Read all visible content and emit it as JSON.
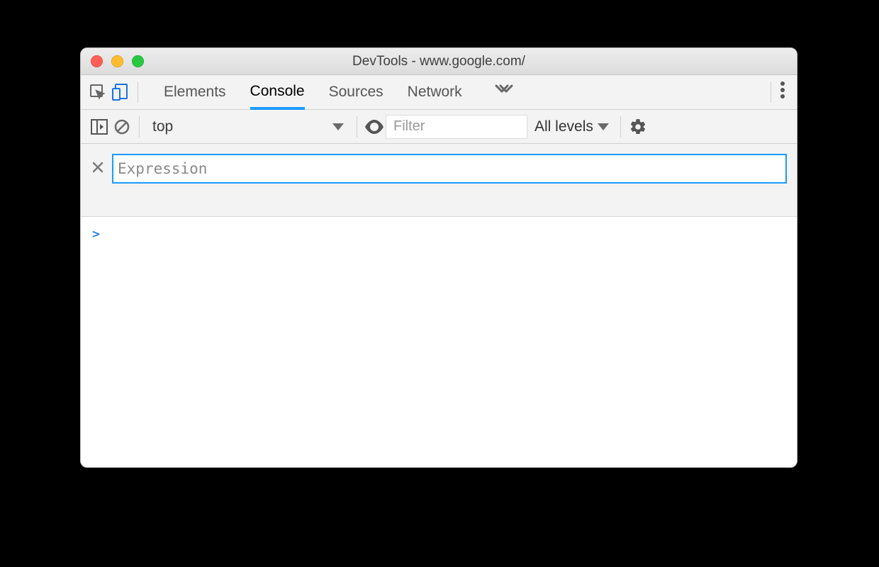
{
  "window": {
    "title": "DevTools - www.google.com/"
  },
  "tabs": {
    "items": [
      "Elements",
      "Console",
      "Sources",
      "Network"
    ],
    "active_index": 1
  },
  "console_toolbar": {
    "context": "top",
    "filter_placeholder": "Filter",
    "levels_label": "All levels"
  },
  "live_expression": {
    "placeholder": "Expression"
  },
  "prompt_symbol": ">"
}
